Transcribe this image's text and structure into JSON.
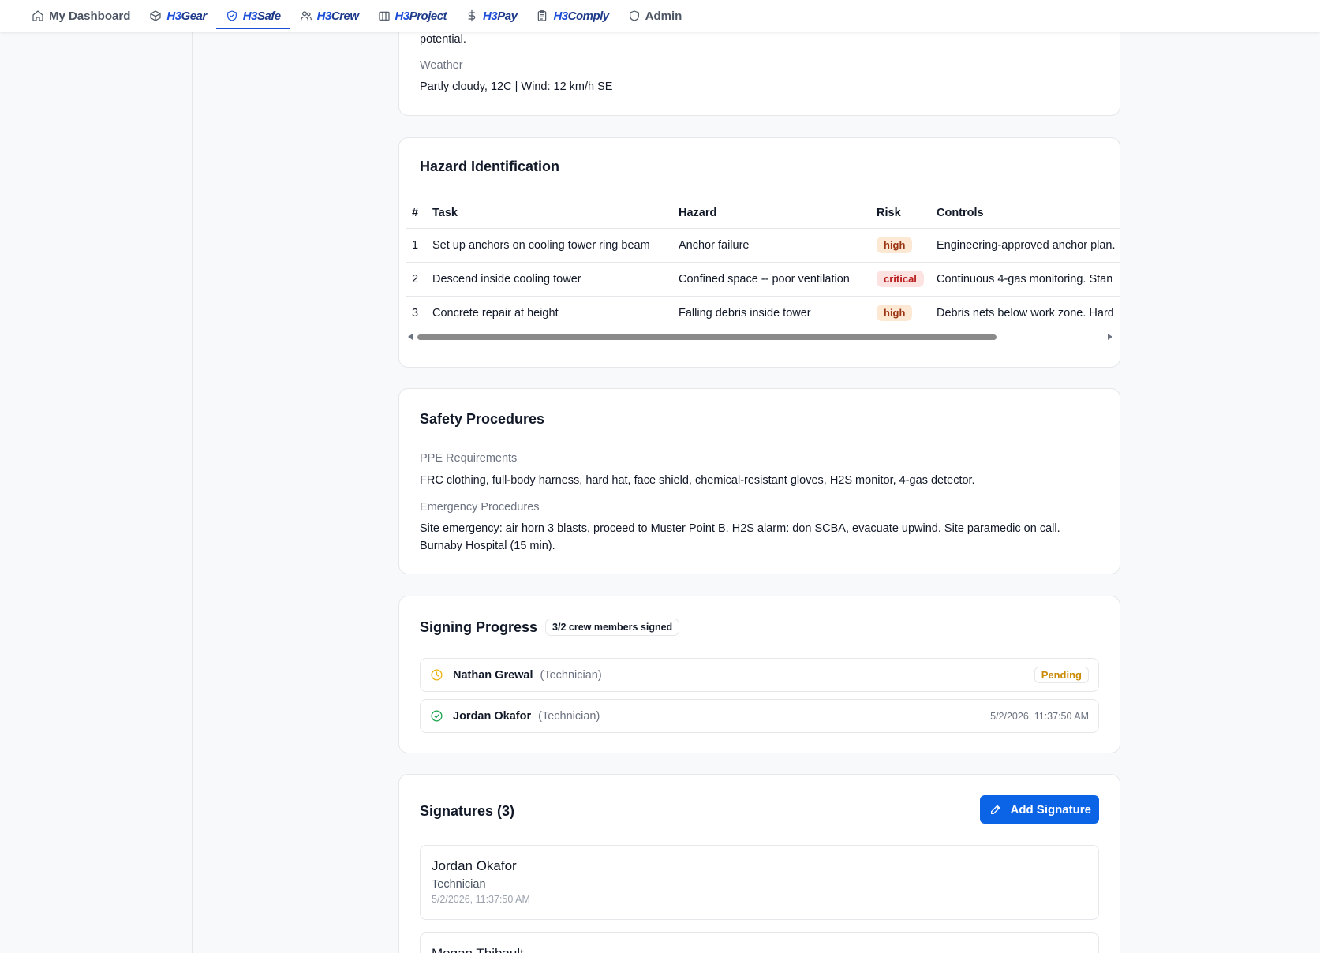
{
  "nav": {
    "dashboard": "My Dashboard",
    "gear": {
      "h3": "H3",
      "rest": "Gear"
    },
    "safe": {
      "h3": "H3",
      "rest": "Safe"
    },
    "crew": {
      "h3": "H3",
      "rest": "Crew"
    },
    "project": {
      "h3": "H3",
      "rest": "Project"
    },
    "pay": {
      "h3": "H3",
      "rest": "Pay"
    },
    "comply": {
      "h3": "H3",
      "rest": "Comply"
    },
    "admin": "Admin",
    "active": "safe"
  },
  "site_conditions": {
    "overflow_text": "potential.",
    "weather_label": "Weather",
    "weather_value": "Partly cloudy, 12C | Wind: 12 km/h SE"
  },
  "hazards": {
    "title": "Hazard Identification",
    "columns": {
      "num": "#",
      "task": "Task",
      "hazard": "Hazard",
      "risk": "Risk",
      "controls": "Controls"
    },
    "rows": [
      {
        "num": "1",
        "task": "Set up anchors on cooling tower ring beam",
        "hazard": "Anchor failure",
        "risk": "high",
        "controls": "Engineering-approved anchor plan."
      },
      {
        "num": "2",
        "task": "Descend inside cooling tower",
        "hazard": "Confined space -- poor ventilation",
        "risk": "critical",
        "controls": "Continuous 4-gas monitoring. Stan"
      },
      {
        "num": "3",
        "task": "Concrete repair at height",
        "hazard": "Falling debris inside tower",
        "risk": "high",
        "controls": "Debris nets below work zone. Hard"
      }
    ]
  },
  "procedures": {
    "title": "Safety Procedures",
    "ppe_label": "PPE Requirements",
    "ppe_value": "FRC clothing, full-body harness, hard hat, face shield, chemical-resistant gloves, H2S monitor, 4-gas detector.",
    "emergency_label": "Emergency Procedures",
    "emergency_value": "Site emergency: air horn 3 blasts, proceed to Muster Point B. H2S alarm: don SCBA, evacuate upwind. Site paramedic on call. Burnaby Hospital (15 min)."
  },
  "signing": {
    "title": "Signing Progress",
    "count_pill": "3/2 crew members signed",
    "members": [
      {
        "name": "Nathan Grewal",
        "role": "(Technician)",
        "status": "Pending"
      },
      {
        "name": "Jordan Okafor",
        "role": "(Technician)",
        "timestamp": "5/2/2026, 11:37:50 AM"
      }
    ]
  },
  "signatures": {
    "title": "Signatures (3)",
    "add_label": "Add Signature",
    "items": [
      {
        "name": "Jordan Okafor",
        "role": "Technician",
        "timestamp": "5/2/2026, 11:37:50 AM"
      },
      {
        "name": "Megan Thibault"
      }
    ]
  }
}
